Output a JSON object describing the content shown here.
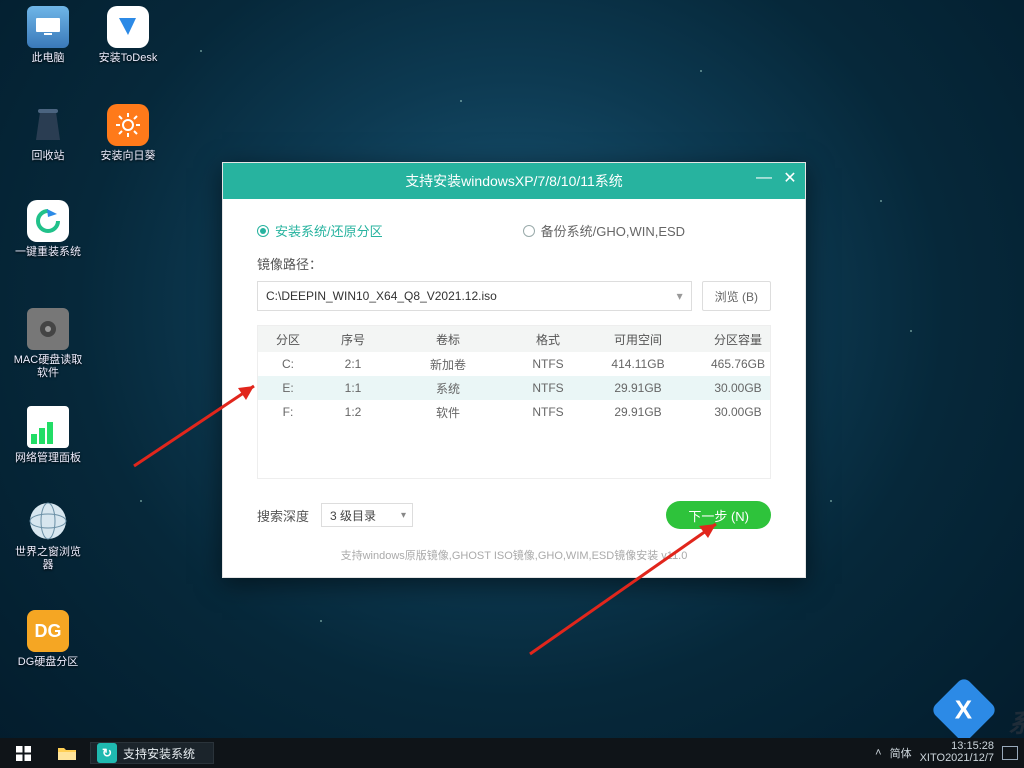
{
  "desktop_icons": [
    {
      "label": "此电脑"
    },
    {
      "label": "安装ToDesk"
    },
    {
      "label": "回收站"
    },
    {
      "label": "安装向日葵"
    },
    {
      "label": "一键重装系统"
    },
    {
      "label": "MAC硬盘读取软件"
    },
    {
      "label": "网络管理面板"
    },
    {
      "label": "世界之窗浏览器"
    },
    {
      "label": "DG硬盘分区"
    }
  ],
  "window": {
    "title": "支持安装windowsXP/7/8/10/11系统",
    "tabs": {
      "install": "安装系统/还原分区",
      "backup": "备份系统/GHO,WIN,ESD"
    },
    "path_label": "镜像路径：",
    "path_value": "C:\\DEEPIN_WIN10_X64_Q8_V2021.12.iso",
    "browse_label": "浏览 (B)",
    "table": {
      "headers": [
        "分区",
        "序号",
        "卷标",
        "格式",
        "可用空间",
        "分区容量"
      ],
      "rows": [
        {
          "drive": "C:",
          "num": "2:1",
          "vol": "新加卷",
          "fmt": "NTFS",
          "free": "414.11GB",
          "size": "465.76GB",
          "selected": false
        },
        {
          "drive": "E:",
          "num": "1:1",
          "vol": "系统",
          "fmt": "NTFS",
          "free": "29.91GB",
          "size": "30.00GB",
          "selected": true
        },
        {
          "drive": "F:",
          "num": "1:2",
          "vol": "软件",
          "fmt": "NTFS",
          "free": "29.91GB",
          "size": "30.00GB",
          "selected": false
        }
      ]
    },
    "search_depth_label": "搜索深度",
    "search_depth_value": "3 级目录",
    "next_label": "下一步 (N)",
    "hint": "支持windows原版镜像,GHOST ISO镜像,GHO,WIM,ESD镜像安装 v11.0"
  },
  "taskbar": {
    "task_title": "支持安装系统",
    "ime": "简体",
    "time": "13:15:28",
    "date": "XITO2021/12/7"
  },
  "watermark": "系统"
}
